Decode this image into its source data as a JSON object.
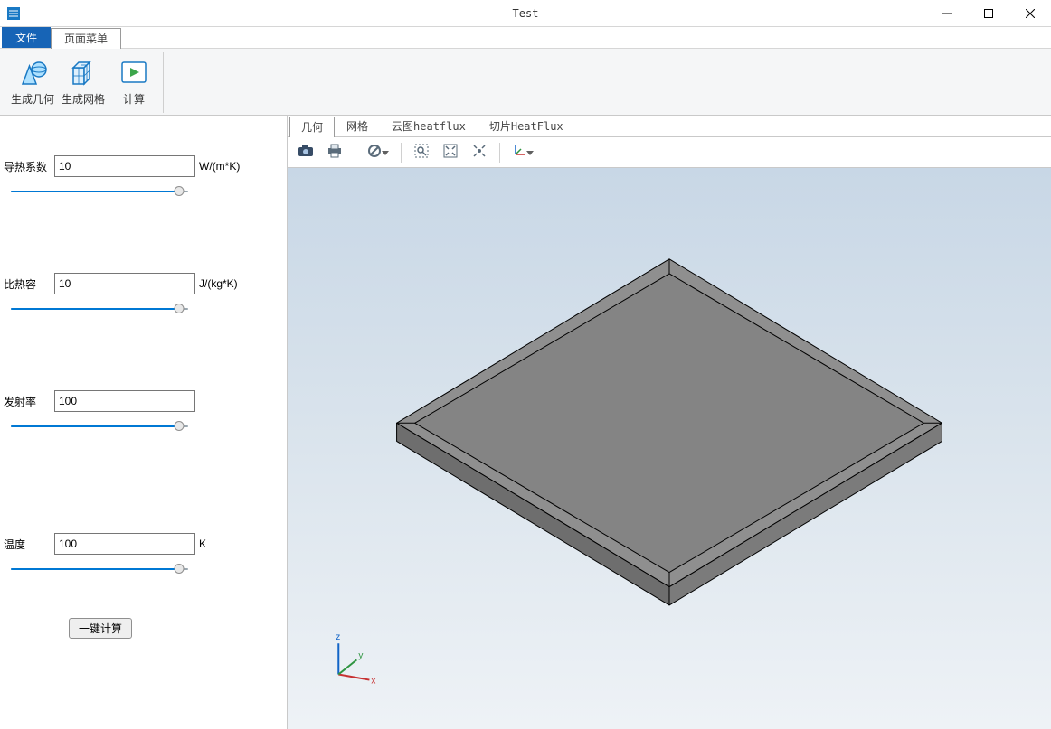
{
  "window": {
    "title": "Test"
  },
  "ribbon": {
    "file_tab": "文件",
    "page_menu_tab": "页面菜单",
    "btn_geometry": "生成几何",
    "btn_mesh": "生成网格",
    "btn_compute": "计算"
  },
  "form": {
    "thermal_conductivity": {
      "label": "导热系数",
      "value": "10",
      "unit": "W/(m*K)"
    },
    "specific_heat": {
      "label": "比热容",
      "value": "10",
      "unit": "J/(kg*K)"
    },
    "emissivity": {
      "label": "发射率",
      "value": "100",
      "unit": ""
    },
    "temperature": {
      "label": "温度",
      "value": "100",
      "unit": "K"
    },
    "one_click_calc": "一键计算"
  },
  "gfx": {
    "tabs": {
      "geometry": "几何",
      "mesh": "网格",
      "contour": "云图heatflux",
      "slice": "切片HeatFlux"
    },
    "axes": {
      "x": "x",
      "y": "y",
      "z": "z"
    }
  }
}
